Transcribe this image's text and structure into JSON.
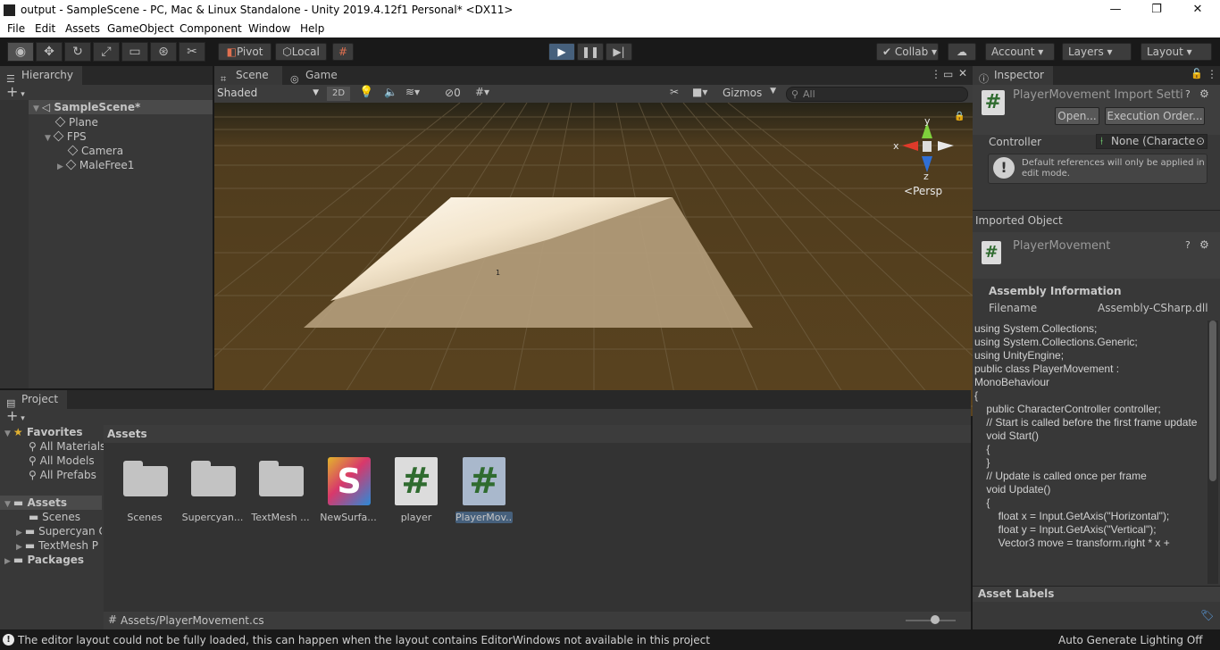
{
  "window": {
    "title": "output - SampleScene - PC, Mac & Linux Standalone - Unity 2019.4.12f1 Personal* <DX11>",
    "controls": [
      "—",
      "❐",
      "✕"
    ]
  },
  "menu": [
    "File",
    "Edit",
    "Assets",
    "GameObject",
    "Component",
    "Window",
    "Help"
  ],
  "toolbar": {
    "pivot": "Pivot",
    "local": "Local",
    "collab": "Collab",
    "account": "Account",
    "layers": "Layers",
    "layout": "Layout"
  },
  "hierarchy": {
    "tab": "Hierarchy",
    "add": "+",
    "items": [
      {
        "label": "SampleScene*",
        "depth": 0
      },
      {
        "label": "Plane",
        "depth": 1
      },
      {
        "label": "FPS",
        "depth": 1
      },
      {
        "label": "Camera",
        "depth": 2
      },
      {
        "label": "MaleFree1",
        "depth": 2
      }
    ]
  },
  "scene": {
    "tabs": [
      "Scene",
      "Game"
    ],
    "shading": "Shaded",
    "mode2d": "2D",
    "hidden_count": "0",
    "gizmos": "Gizmos",
    "search_placeholder": "All",
    "gizmo_axes": {
      "x": "x",
      "y": "y",
      "z": "z"
    },
    "persp": "Persp",
    "marker": "1"
  },
  "project": {
    "tab": "Project",
    "add": "+",
    "favorites": {
      "label": "Favorites",
      "items": [
        "All Materials",
        "All Models",
        "All Prefabs"
      ]
    },
    "assets_root": {
      "label": "Assets",
      "items": [
        "Scenes",
        "Supercyan C",
        "TextMesh P"
      ]
    },
    "packages": "Packages",
    "breadcrumb": "Assets",
    "assets": [
      {
        "label": "Scenes",
        "kind": "folder"
      },
      {
        "label": "Supercyan...",
        "kind": "folder"
      },
      {
        "label": "TextMesh ...",
        "kind": "folder"
      },
      {
        "label": "NewSurfa...",
        "kind": "shader",
        "glyph": "S"
      },
      {
        "label": "player",
        "kind": "script",
        "glyph": "#"
      },
      {
        "label": "PlayerMov...",
        "kind": "script",
        "glyph": "#"
      }
    ],
    "path": "Assets/PlayerMovement.cs"
  },
  "inspector": {
    "tab": "Inspector",
    "title": "PlayerMovement Import Setti",
    "open_button": "Open...",
    "execution_order_button": "Execution Order...",
    "controller_label": "Controller",
    "controller_value": "None (Characte",
    "info_text": "Default references will only be applied in edit mode.",
    "imported_object": "Imported Object",
    "object_name": "PlayerMovement",
    "assembly_info": "Assembly Information",
    "filename_label": "Filename",
    "filename_value": "Assembly-CSharp.dll",
    "code": [
      "using System.Collections;",
      "using System.Collections.Generic;",
      "using UnityEngine;",
      "",
      "public class PlayerMovement :",
      "MonoBehaviour",
      "{",
      "    public CharacterController controller;",
      "    // Start is called before the first frame update",
      "    void Start()",
      "    {",
      "",
      "    }",
      "",
      "    // Update is called once per frame",
      "    void Update()",
      "    {",
      "        float x = Input.GetAxis(\"Horizontal\");",
      "        float y = Input.GetAxis(\"Vertical\");",
      "        Vector3 move = transform.right * x +"
    ],
    "asset_labels": "Asset Labels"
  },
  "status": {
    "message": "The editor layout could not be fully loaded, this can happen when the layout contains EditorWindows not available in this project",
    "right": "Auto Generate Lighting Off"
  }
}
